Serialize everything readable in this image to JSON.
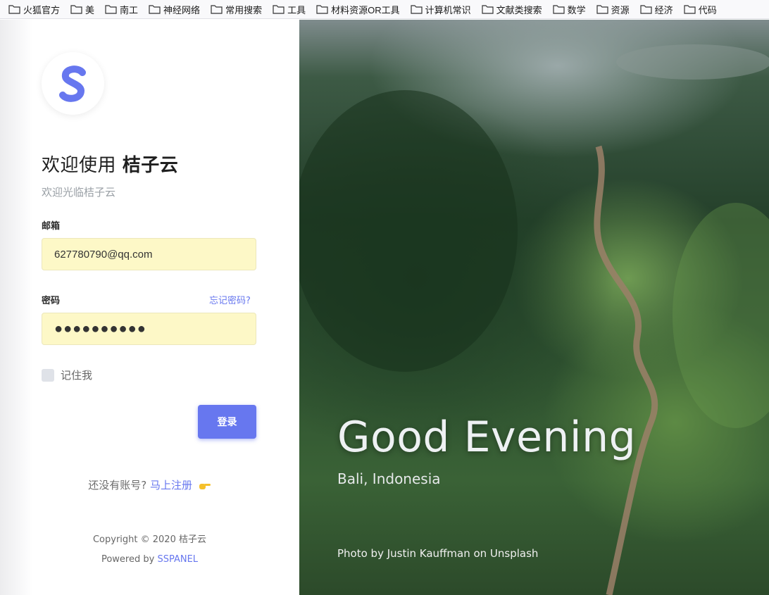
{
  "bookmarks": [
    "火狐官方",
    "美",
    "南工",
    "神经网络",
    "常用搜索",
    "工具",
    "材料资源OR工具",
    "计算机常识",
    "文献类搜索",
    "数学",
    "资源",
    "经济",
    "代码"
  ],
  "login": {
    "logo_letter": "S",
    "title_prefix": "欢迎使用",
    "title_brand": "桔子云",
    "subtitle": "欢迎光临桔子云",
    "email_label": "邮箱",
    "email_value": "627780790@qq.com",
    "password_label": "密码",
    "forgot_label": "忘记密码?",
    "password_mask": "●●●●●●●●●●",
    "remember_label": "记住我",
    "login_button": "登录",
    "register_prompt": "还没有账号?",
    "register_link": "马上注册",
    "copyright": "Copyright © 2020 桔子云",
    "powered_prefix": "Powered by",
    "powered_link": "SSPANEL"
  },
  "hero": {
    "greeting": "Good Evening",
    "location": "Bali, Indonesia",
    "credit": "Photo by Justin Kauffman on Unsplash"
  },
  "colors": {
    "accent": "#6777ef",
    "autofill": "#fdf8c7",
    "text_muted": "#9aa0a6"
  }
}
